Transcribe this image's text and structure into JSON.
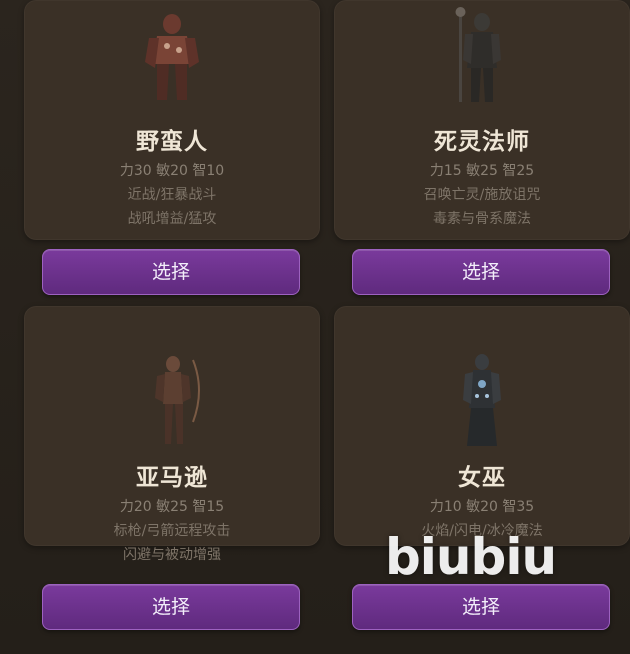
{
  "classes": [
    {
      "name": "野蛮人",
      "stats": "力30 敏20 智10",
      "desc1": "近战/狂暴战斗",
      "desc2": "战吼增益/猛攻",
      "button": "选择",
      "icon": "barbarian-portrait"
    },
    {
      "name": "死灵法师",
      "stats": "力15 敏25 智25",
      "desc1": "召唤亡灵/施放诅咒",
      "desc2": "毒素与骨系魔法",
      "button": "选择",
      "icon": "necromancer-portrait"
    },
    {
      "name": "亚马逊",
      "stats": "力20 敏25 智15",
      "desc1": "标枪/弓箭远程攻击",
      "desc2": "闪避与被动增强",
      "button": "选择",
      "icon": "amazon-portrait"
    },
    {
      "name": "女巫",
      "stats": "力10 敏20 智35",
      "desc1": "火焰/闪电/冰冷魔法",
      "desc2": "",
      "button": "选择",
      "icon": "sorceress-portrait"
    }
  ],
  "watermark": "biubiu"
}
